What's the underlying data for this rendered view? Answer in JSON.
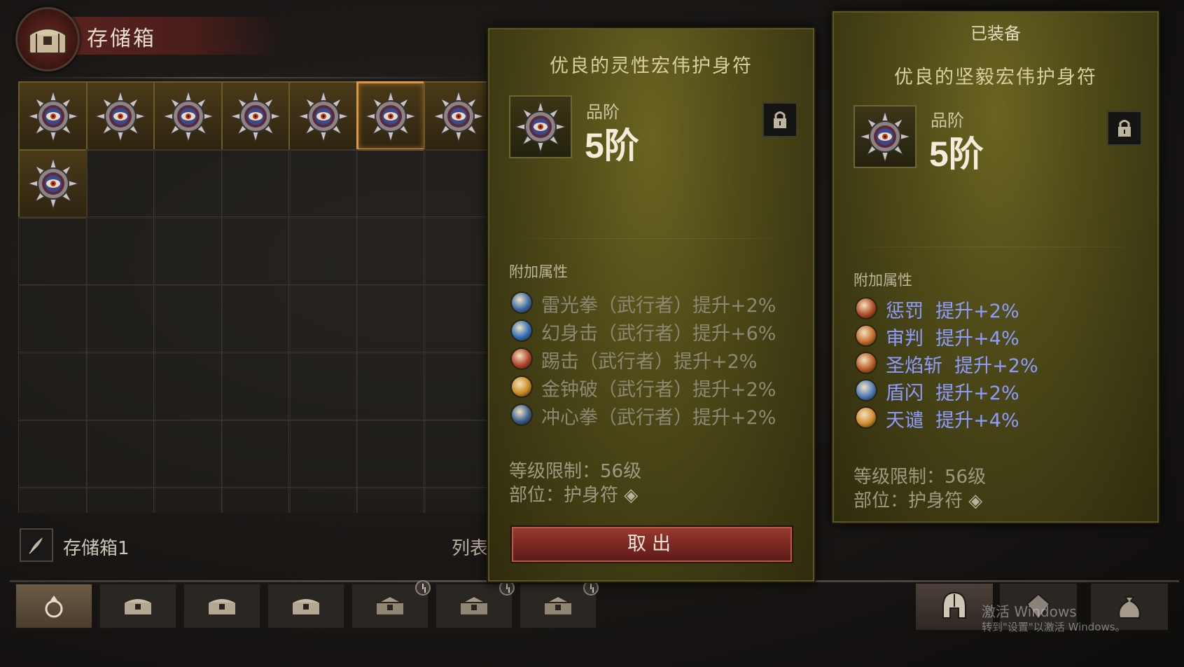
{
  "stash": {
    "title": "存储箱",
    "name": "存储箱1",
    "list_label": "列表"
  },
  "grid": {
    "filled_slots": [
      {
        "row": 0,
        "col": 0,
        "item": "amulet-icon"
      },
      {
        "row": 0,
        "col": 1,
        "item": "amulet-icon"
      },
      {
        "row": 0,
        "col": 2,
        "item": "amulet-icon"
      },
      {
        "row": 0,
        "col": 3,
        "item": "amulet-icon"
      },
      {
        "row": 0,
        "col": 4,
        "item": "amulet-icon"
      },
      {
        "row": 0,
        "col": 5,
        "item": "amulet-icon",
        "selected": true
      },
      {
        "row": 0,
        "col": 6,
        "item": "amulet-icon"
      },
      {
        "row": 1,
        "col": 0,
        "item": "amulet-icon"
      }
    ]
  },
  "selected_item": {
    "name": "优良的灵性宏伟护身符",
    "grade_label": "品阶",
    "grade_value": "5阶",
    "attributes_label": "附加属性",
    "attributes": [
      {
        "icon": "lightning-fist-icon",
        "text": "雷光拳（武行者）提升+2%",
        "color": "#3a6aa8"
      },
      {
        "icon": "phantom-strike-icon",
        "text": "幻身击（武行者）提升+6%",
        "color": "#2f6fb8"
      },
      {
        "icon": "kick-icon",
        "text": "踢击（武行者）提升+2%",
        "color": "#b0452a"
      },
      {
        "icon": "golden-bell-icon",
        "text": "金钟破（武行者）提升+2%",
        "color": "#c98a1f"
      },
      {
        "icon": "heart-fist-icon",
        "text": "冲心拳（武行者）提升+2%",
        "color": "#3a5f8e"
      }
    ],
    "level_req": "等级限制：56级",
    "slot": "部位：护身符",
    "take_out_button": "取出"
  },
  "equipped_item": {
    "equipped_label": "已装备",
    "name": "优良的坚毅宏伟护身符",
    "grade_label": "品阶",
    "grade_value": "5阶",
    "attributes_label": "附加属性",
    "attributes": [
      {
        "icon": "punish-icon",
        "skill": "惩罚",
        "value": "提升+2%",
        "color": "#b04a26"
      },
      {
        "icon": "judgment-icon",
        "skill": "审判",
        "value": "提升+4%",
        "color": "#c46a2a"
      },
      {
        "icon": "flame-slash-icon",
        "skill": "圣焰斩",
        "value": "提升+2%",
        "color": "#b85a22"
      },
      {
        "icon": "shield-flash-icon",
        "skill": "盾闪",
        "value": "提升+2%",
        "color": "#4a7ab8"
      },
      {
        "icon": "condemnation-icon",
        "skill": "天谴",
        "value": "提升+4%",
        "color": "#d08a2a"
      }
    ],
    "level_req": "等级限制：56级",
    "slot": "部位：护身符"
  },
  "tabs": [
    {
      "icon": "ring-icon",
      "active": true
    },
    {
      "icon": "chest-icon"
    },
    {
      "icon": "chest-icon"
    },
    {
      "icon": "chest-icon"
    },
    {
      "icon": "chest-locked-icon",
      "timed": true
    },
    {
      "icon": "chest-locked-icon",
      "timed": true
    },
    {
      "icon": "chest-locked-icon",
      "timed": true
    }
  ],
  "right_tabs": [
    {
      "icon": "helmet-icon",
      "active": true
    },
    {
      "icon": "gem-icon"
    },
    {
      "icon": "bag-icon"
    }
  ],
  "watermark": {
    "line1": "激活 Windows",
    "line2": "转到\"设置\"以激活 Windows。"
  }
}
